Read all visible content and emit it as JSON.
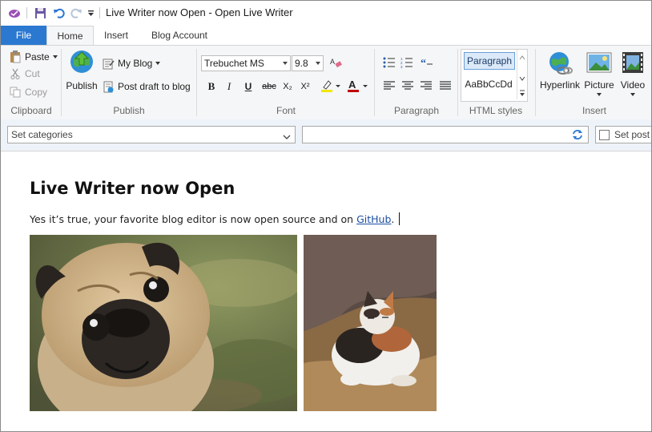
{
  "window": {
    "title": "Live Writer now Open - Open Live Writer"
  },
  "tabs": [
    {
      "label": "File"
    },
    {
      "label": "Home"
    },
    {
      "label": "Insert"
    },
    {
      "label": "Blog Account"
    }
  ],
  "ribbon": {
    "clipboard": {
      "group": "Clipboard",
      "paste": "Paste",
      "cut": "Cut",
      "copy": "Copy"
    },
    "publish": {
      "group": "Publish",
      "publish": "Publish",
      "my_blog": "My Blog",
      "post_draft": "Post draft to blog"
    },
    "font": {
      "group": "Font",
      "family": "Trebuchet MS",
      "size": "9.8",
      "bold": "B",
      "italic": "I",
      "underline": "U",
      "strike": "abc",
      "subscript": "X₂",
      "superscript": "X²"
    },
    "paragraph": {
      "group": "Paragraph"
    },
    "styles": {
      "group": "HTML styles",
      "style1": "Paragraph",
      "style2": "AaBbCcDd"
    },
    "insert": {
      "group": "Insert",
      "hyperlink": "Hyperlink",
      "picture": "Picture",
      "video": "Video"
    }
  },
  "props": {
    "categories_placeholder": "Set categories",
    "tags_value": "",
    "post_date": "Set post d"
  },
  "post": {
    "title": "Live Writer now Open",
    "body_text": "Yes it’s true, your favorite blog editor is now open source and on ",
    "link_text": "GitHub",
    "after_link": "."
  },
  "colors": {
    "accent": "#2b78d0",
    "highlight": "#f2e600",
    "font_color": "#c00000",
    "link": "#1a4fa0"
  }
}
